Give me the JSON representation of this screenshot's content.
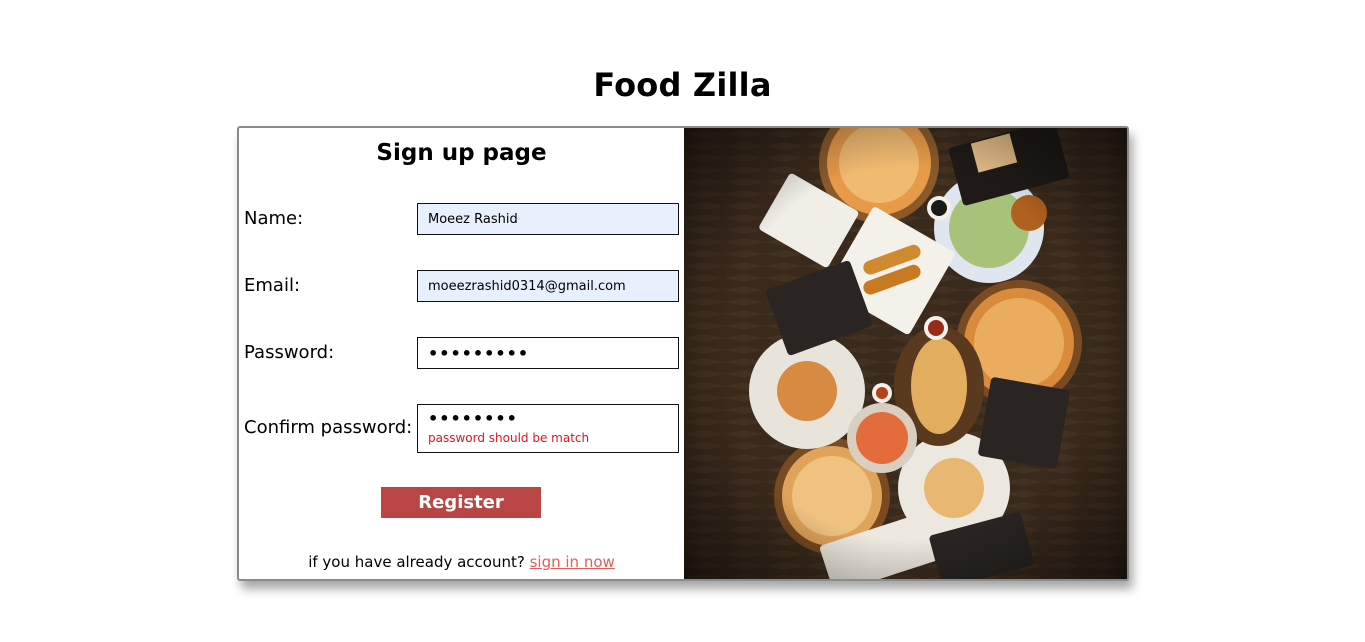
{
  "header": {
    "title": "Food Zilla"
  },
  "form": {
    "title": "Sign up page",
    "name": {
      "label": "Name:",
      "value": "Moeez Rashid"
    },
    "email": {
      "label": "Email:",
      "value": "moeezrashid0314@gmail.com"
    },
    "password": {
      "label": "Password:",
      "value": "•••••••••"
    },
    "confirm": {
      "label": "Confirm password:",
      "value": "••••••••",
      "error": "password should be match"
    },
    "register_label": "Register",
    "signin_prompt": "if you have already account?",
    "signin_link": "sign in now"
  },
  "colors": {
    "button": "#b94545",
    "link": "#e85a5a",
    "error": "#e0141e",
    "autofill": "#e8f0fe"
  },
  "image": {
    "semantic": "food-spread-photo"
  }
}
